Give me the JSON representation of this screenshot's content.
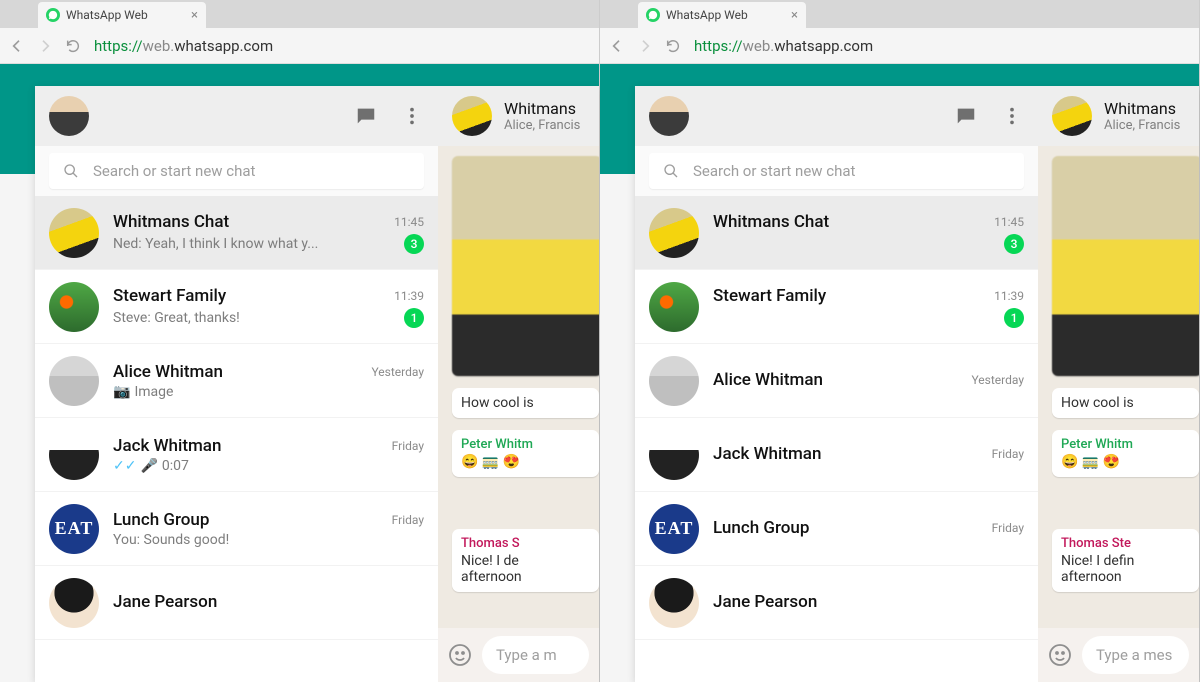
{
  "browser": {
    "tab_title": "WhatsApp Web",
    "url_proto": "https://",
    "url_host": "web.",
    "url_rest": "whatsapp.com"
  },
  "app": {
    "search_placeholder": "Search or start new chat",
    "compose_placeholder_left": "Type a m",
    "compose_placeholder_right": "Type a mes"
  },
  "header_chat": {
    "name_partial": "Whitmans",
    "subtitle_partial": "Alice, Francis"
  },
  "chats": [
    {
      "name": "Whitmans Chat",
      "preview": "Ned: Yeah, I think I know what y...",
      "time": "11:45",
      "badge": "3",
      "av": "av-yellow",
      "selected": true
    },
    {
      "name": "Stewart Family",
      "preview": "Steve: Great, thanks!",
      "time": "11:39",
      "badge": "1",
      "av": "av-green"
    },
    {
      "name": "Alice Whitman",
      "preview": "Image",
      "preview_icon": "camera",
      "time": "Yesterday",
      "av": "av-grey"
    },
    {
      "name": "Jack Whitman",
      "preview": "0:07",
      "preview_icon": "voice",
      "time": "Friday",
      "av": "av-bw"
    },
    {
      "name": "Lunch Group",
      "preview": "You: Sounds good!",
      "time": "Friday",
      "av": "av-eat",
      "av_text": "EAT"
    },
    {
      "name": "Jane Pearson",
      "preview": "",
      "time": "",
      "av": "av-jane"
    }
  ],
  "messages": {
    "m1_text": "How cool is",
    "m2_name": "Peter Whitm",
    "m2_emoji": "😄 🚃 😍",
    "m3_name_left": "Thomas S",
    "m3_name_right": "Thomas Ste",
    "m3_text_left": "Nice! I de",
    "m3_text_right": "Nice! I defin",
    "m3_text2": "afternoon"
  }
}
